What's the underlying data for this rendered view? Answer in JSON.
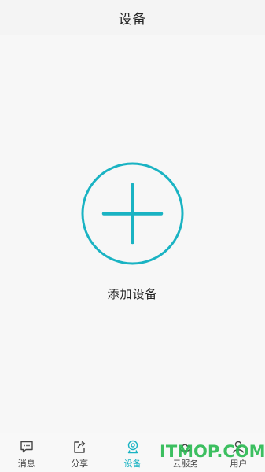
{
  "header": {
    "title": "设备"
  },
  "main": {
    "add_device_label": "添加设备"
  },
  "tabs": [
    {
      "label": "消息",
      "icon": "message-icon",
      "active": false
    },
    {
      "label": "分享",
      "icon": "share-icon",
      "active": false
    },
    {
      "label": "设备",
      "icon": "device-icon",
      "active": true
    },
    {
      "label": "云服务",
      "icon": "cloud-service-icon",
      "active": false
    },
    {
      "label": "用户",
      "icon": "user-icon",
      "active": false
    }
  ],
  "watermark": {
    "text": "ITMOP.COM"
  },
  "colors": {
    "accent": "#1ab3c3",
    "watermark": "#2dbb54",
    "tab_inactive": "#444444"
  }
}
